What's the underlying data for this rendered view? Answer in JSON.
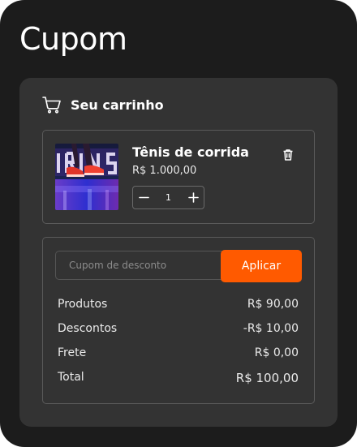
{
  "page": {
    "title": "Cupom"
  },
  "cart": {
    "title": "Seu carrinho",
    "cart_icon": "cart-icon",
    "item": {
      "name": "Tênis de corrida",
      "price": "R$ 1.000,00",
      "quantity": "1",
      "image": "running-shoes-photo",
      "delete_icon": "trash-icon",
      "decrease_icon": "minus-icon",
      "increase_icon": "plus-icon"
    }
  },
  "coupon": {
    "placeholder": "Cupom de desconto",
    "value": "",
    "apply_label": "Aplicar"
  },
  "summary": {
    "products_label": "Produtos",
    "products_value": "R$ 90,00",
    "discounts_label": "Descontos",
    "discounts_value": "-R$ 10,00",
    "shipping_label": "Frete",
    "shipping_value": "R$ 0,00",
    "total_label": "Total",
    "total_value": "R$ 100,00"
  },
  "colors": {
    "background": "#1c1c1c",
    "card": "#333333",
    "accent": "#ff5a00",
    "text": "#ffffff"
  }
}
